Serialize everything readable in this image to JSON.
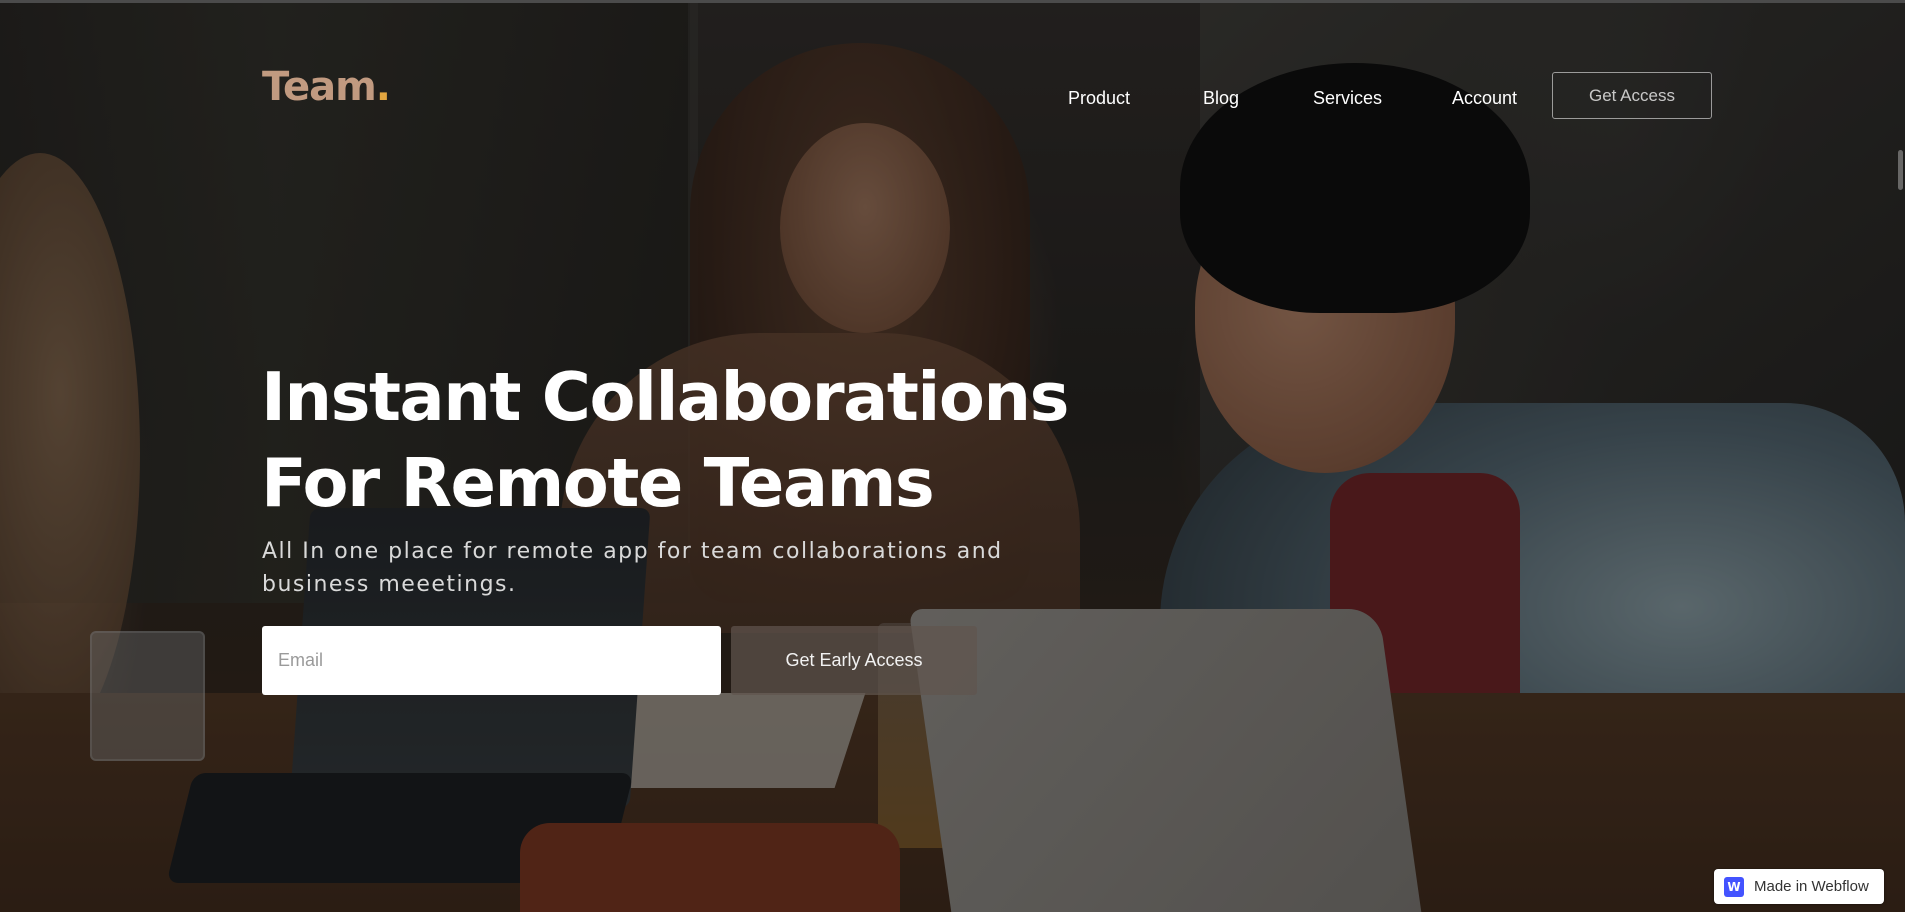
{
  "brand": {
    "name": "Team",
    "dot": "."
  },
  "nav": {
    "items": [
      {
        "label": "Product"
      },
      {
        "label": "Blog"
      },
      {
        "label": "Services"
      },
      {
        "label": "Account"
      }
    ],
    "cta_label": "Get Access"
  },
  "hero": {
    "headline_line1": "Instant Collaborations",
    "headline_line2": "For Remote Teams",
    "subheadline": "All In one place for remote app for team collaborations and business meeetings.",
    "email_placeholder": "Email",
    "cta_label": "Get Early Access"
  },
  "badge": {
    "icon_letter": "W",
    "label": "Made in Webflow"
  },
  "colors": {
    "brand_text": "#c19a80",
    "brand_dot": "#e2a53f",
    "webflow_blue": "#4353ff"
  },
  "icons": {
    "badge_icon": "webflow-logo-icon"
  }
}
